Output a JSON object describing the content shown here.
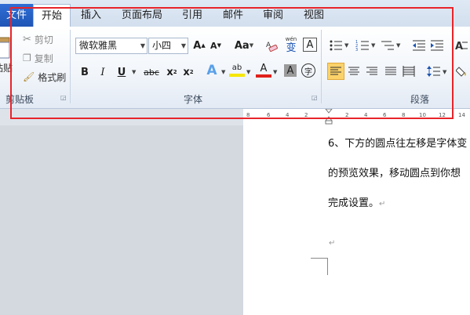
{
  "tabs": {
    "file": "文件",
    "items": [
      "开始",
      "插入",
      "页面布局",
      "引用",
      "邮件",
      "审阅",
      "视图"
    ],
    "active": 0
  },
  "clipboard": {
    "paste_label": "粘贴",
    "cut": "剪切",
    "copy": "复制",
    "format_painter": "格式刷",
    "group_label": "剪贴板"
  },
  "font": {
    "font_name": "微软雅黑",
    "font_size": "小四",
    "grow": "A",
    "shrink": "A",
    "change_case": "Aa",
    "phonetic": "wén",
    "phonetic_char": "变",
    "char_border": "A",
    "bold": "B",
    "italic": "I",
    "underline": "U",
    "strike": "abc",
    "subscript": "x",
    "superscript": "x",
    "text_effects": "A",
    "highlight": "ab",
    "font_color": "A",
    "char_shading": "A",
    "enclose": "字",
    "group_label": "字体"
  },
  "paragraph": {
    "group_label": "段落"
  },
  "ruler": {
    "ticks": [
      "8",
      "6",
      "4",
      "2",
      "2",
      "4",
      "6",
      "8",
      "10",
      "12",
      "14"
    ]
  },
  "document": {
    "line1": "6、下方的圆点往左移是字体变",
    "line2": "的预览效果，移动圆点到你想",
    "line3": "完成设置。",
    "para_mark": "↵"
  },
  "colors": {
    "highlight_box": "#e8242a",
    "file_tab": "#2a63c8",
    "highlight_yellow": "#f6e600",
    "font_red": "#e0201b",
    "align_active": "#fbd26a"
  }
}
